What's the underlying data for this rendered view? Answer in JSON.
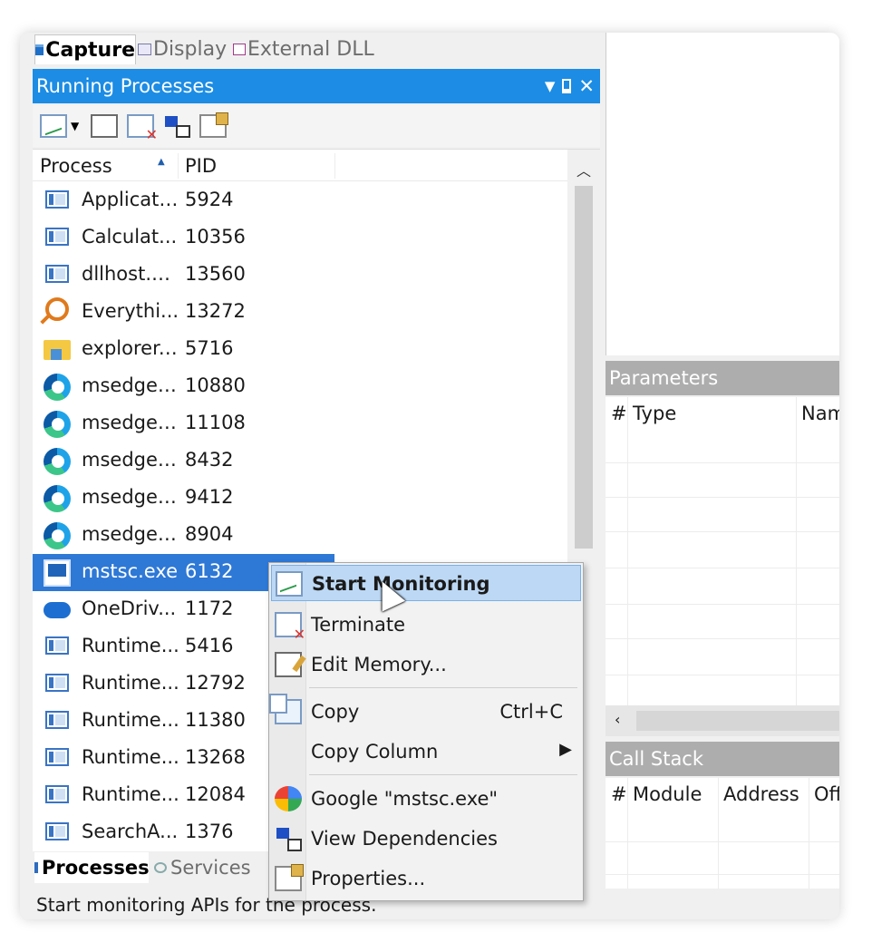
{
  "top_tabs": [
    {
      "label": "Capture",
      "icon": "capture-icon",
      "active": true
    },
    {
      "label": "Display",
      "icon": "display-icon",
      "active": false
    },
    {
      "label": "External DLL",
      "icon": "dll-icon",
      "active": false
    }
  ],
  "panel": {
    "title": "Running Processes",
    "buttons": [
      "dropdown-icon",
      "pin-icon",
      "close-icon"
    ],
    "toolbar": [
      "start-monitoring-icon",
      "dropdown-arrow-icon",
      "edit-memory-icon",
      "terminate-icon",
      "view-dependencies-icon",
      "properties-icon"
    ]
  },
  "list": {
    "columns": [
      "Process",
      "PID"
    ],
    "sort_column": "Process",
    "selected_index": 10,
    "rows": [
      {
        "name": "Applicati...",
        "pid": "5924",
        "icon": "app-window-icon"
      },
      {
        "name": "Calculat...",
        "pid": "10356",
        "icon": "app-window-icon"
      },
      {
        "name": "dllhost.e...",
        "pid": "13560",
        "icon": "app-window-icon"
      },
      {
        "name": "Everythi...",
        "pid": "13272",
        "icon": "magnifier-icon"
      },
      {
        "name": "explorer....",
        "pid": "5716",
        "icon": "folder-icon"
      },
      {
        "name": "msedge....",
        "pid": "10880",
        "icon": "edge-icon"
      },
      {
        "name": "msedge....",
        "pid": "11108",
        "icon": "edge-icon"
      },
      {
        "name": "msedge....",
        "pid": "8432",
        "icon": "edge-icon"
      },
      {
        "name": "msedge....",
        "pid": "9412",
        "icon": "edge-icon"
      },
      {
        "name": "msedge....",
        "pid": "8904",
        "icon": "edge-icon"
      },
      {
        "name": "mstsc.exe",
        "pid": "6132",
        "icon": "remote-desktop-icon"
      },
      {
        "name": "OneDriv...",
        "pid": "1172",
        "icon": "onedrive-icon"
      },
      {
        "name": "Runtime...",
        "pid": "5416",
        "icon": "app-window-icon"
      },
      {
        "name": "Runtime...",
        "pid": "12792",
        "icon": "app-window-icon"
      },
      {
        "name": "Runtime...",
        "pid": "11380",
        "icon": "app-window-icon"
      },
      {
        "name": "Runtime...",
        "pid": "13268",
        "icon": "app-window-icon"
      },
      {
        "name": "Runtime...",
        "pid": "12084",
        "icon": "app-window-icon"
      },
      {
        "name": "SearchA...",
        "pid": "1376",
        "icon": "app-window-icon"
      }
    ]
  },
  "bottom_tabs": [
    {
      "label": "Processes",
      "active": true
    },
    {
      "label": "Services",
      "active": false
    }
  ],
  "status_text": "Start monitoring APIs for the process.",
  "parameters": {
    "title": "Parameters",
    "columns": [
      "#",
      "Type",
      "Nam"
    ]
  },
  "call_stack": {
    "title": "Call Stack",
    "columns": [
      "#",
      "Module",
      "Address",
      "Off"
    ]
  },
  "context_menu": {
    "items": [
      {
        "label": "Start Monitoring",
        "icon": "start-monitoring-icon",
        "highlighted": true
      },
      {
        "label": "Terminate",
        "icon": "terminate-icon"
      },
      {
        "label": "Edit Memory...",
        "icon": "edit-memory-icon"
      },
      {
        "label": "Copy",
        "shortcut": "Ctrl+C",
        "icon": "copy-icon"
      },
      {
        "label": "Copy Column",
        "submenu": true
      },
      {
        "label": "Google \"mstsc.exe\"",
        "icon": "google-icon"
      },
      {
        "label": "View Dependencies",
        "icon": "view-dependencies-icon"
      },
      {
        "label": "Properties...",
        "icon": "properties-icon"
      }
    ],
    "submenu_glyph": "▶"
  },
  "glyphs": {
    "pin": "📌",
    "close": "✕",
    "dropdown": "▼",
    "up": "︿",
    "left": "‹",
    "sort_up": "▲"
  },
  "colors": {
    "accent": "#1c8ce4",
    "selection": "#2e78d6",
    "menu_highlight": "#bcd8f4",
    "section_header": "#adadad"
  }
}
